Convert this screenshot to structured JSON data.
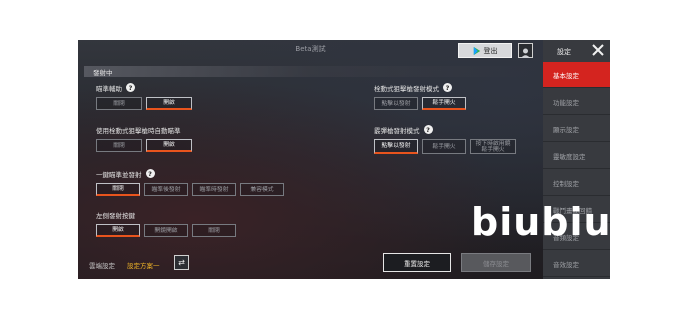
{
  "header": {
    "title": "Beta測試",
    "logout_label": "登出"
  },
  "panel": {
    "section_title": "發射中"
  },
  "groups": {
    "aim_assist": {
      "label": "瞄準輔助",
      "options": [
        "關閉",
        "開啟"
      ],
      "selected": "開啟"
    },
    "auto_aim": {
      "label": "使用栓動式狙擊槍時自動瞄準",
      "options": [
        "關閉",
        "開啟"
      ],
      "selected": "開啟"
    },
    "bolt_fire": {
      "label": "栓動式狙擊槍發射模式",
      "options": [
        "點擊以發射",
        "鬆手開火"
      ],
      "selected": "鬆手開火"
    },
    "shotgun_fire": {
      "label": "霰彈槍發射模式",
      "options": [
        "點擊以發射",
        "鬆手開火",
        "按下時啟用鏡",
        "鬆手開火"
      ],
      "selected": "點擊以發射"
    },
    "one_key": {
      "label": "一鍵瞄準並發射",
      "options": [
        "關閉",
        "瞄準後發射",
        "瞄準時發射",
        "兼容模式"
      ],
      "selected": "關閉"
    },
    "left_fire": {
      "label": "左側發射按鍵",
      "options": [
        "開啟",
        "開鏡開啟",
        "關閉"
      ],
      "selected": "開啟"
    }
  },
  "bottom": {
    "cloud_label": "雲端設定",
    "scheme_label": "設定方案一",
    "reset_label": "重置設定",
    "save_label": "儲存設定"
  },
  "sidebar": {
    "title": "設定",
    "items": [
      "基本設定",
      "功能設定",
      "顯示設定",
      "靈敏度設定",
      "控制設定",
      "戰鬥畫面回饋",
      "音頻設定",
      "音效設定"
    ],
    "active_index": 0
  },
  "watermark": "biubiu",
  "colors": {
    "accent": "#d4241f",
    "highlight": "#e8541d",
    "scheme": "#f0b427"
  }
}
